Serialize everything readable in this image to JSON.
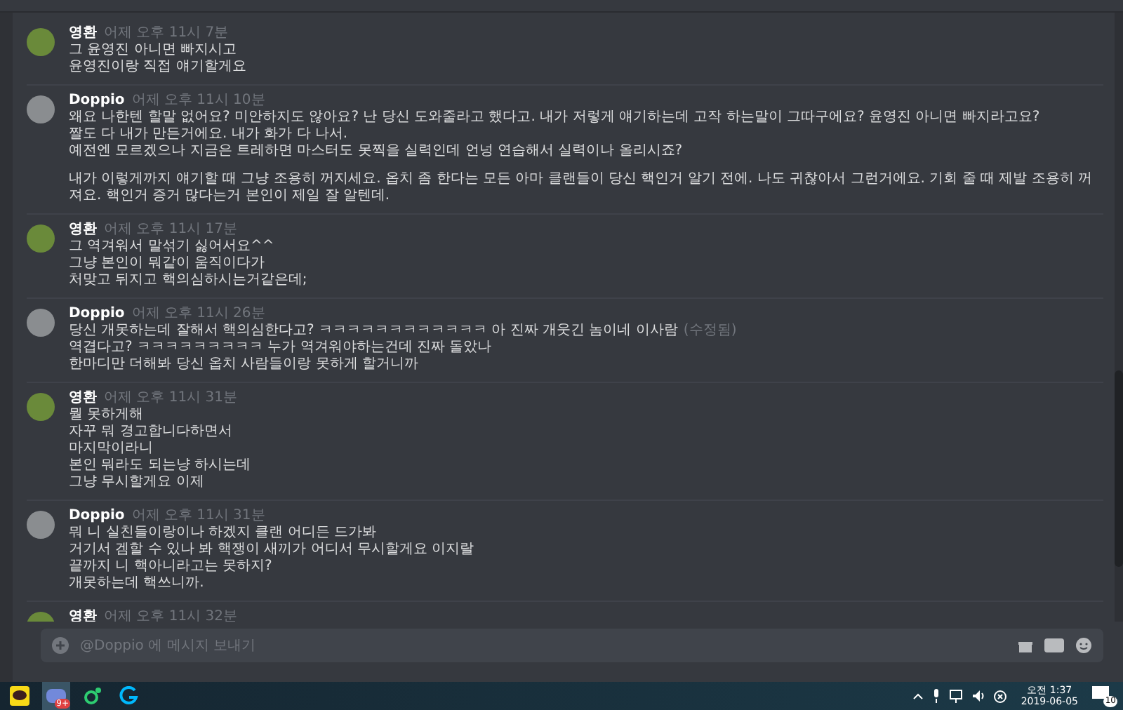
{
  "messages": [
    {
      "author": "영환",
      "time": "어제 오후 11시 7분",
      "color": "#6a8a3a",
      "paragraphs": [
        [
          "그 윤영진 아니면 빠지시고",
          "윤영진이랑 직접 얘기할게요"
        ]
      ]
    },
    {
      "author": "Doppio",
      "time": "어제 오후 11시 10분",
      "color": "#8a8d90",
      "paragraphs": [
        [
          "왜요 나한텐 할말 없어요? 미안하지도 않아요? 난 당신 도와줄라고 했다고. 내가 저렇게 얘기하는데 고작 하는말이 그따구에요? 윤영진 아니면 빠지라고요?",
          "짤도 다 내가 만든거에요. 내가 화가 다 나서.",
          "예전엔 모르겠으나 지금은 트레하면 마스터도 못찍을 실력인데 언넝 연습해서 실력이나 올리시죠?"
        ],
        [
          "내가 이렇게까지 얘기할 때 그냥 조용히 꺼지세요. 옵치 좀 한다는 모든 아마 클랜들이 당신 핵인거 알기 전에. 나도 귀찮아서 그런거에요. 기회 줄 때 제발 조용히 꺼져요. 핵인거 증거 많다는거 본인이 제일 잘 알텐데."
        ]
      ]
    },
    {
      "author": "영환",
      "time": "어제 오후 11시 17분",
      "color": "#6a8a3a",
      "paragraphs": [
        [
          "그 역겨워서 말섞기 싫어서요^^",
          "그냥 본인이 뭐같이 움직이다가",
          "처맞고 뒤지고 핵의심하시는거같은데;"
        ]
      ]
    },
    {
      "author": "Doppio",
      "time": "어제 오후 11시 26분",
      "color": "#8a8d90",
      "edited_tag": "(수정됨)",
      "paragraphs": [
        [
          "당신 개못하는데 잘해서 핵의심한다고? ㅋㅋㅋㅋㅋㅋㅋㅋㅋㅋㅋㅋ 아 진짜 개웃긴 놈이네 이사람",
          "역겹다고? ㅋㅋㅋㅋㅋㅋㅋㅋㅋ 누가 역겨워야하는건데 진짜 돌았나",
          "한마디만 더해봐 당신 옵치 사람들이랑 못하게 할거니까"
        ]
      ]
    },
    {
      "author": "영환",
      "time": "어제 오후 11시 31분",
      "color": "#6a8a3a",
      "paragraphs": [
        [
          "뭘 못하게해",
          "자꾸 뭐 경고합니다하면서",
          "마지막이라니",
          "본인 뭐라도 되는냥 하시는데",
          "그냥 무시할게요 이제"
        ]
      ]
    },
    {
      "author": "Doppio",
      "time": "어제 오후 11시 31분",
      "color": "#8a8d90",
      "paragraphs": [
        [
          "뭐 니 실친들이랑이나 하겠지 클랜 어디든 드가봐",
          "거기서 겜할 수 있나 봐 핵쟁이 새끼가 어디서 무시할게요 이지랄",
          "끝까지 니 핵아니라고는 못하지?",
          "개못하는데 핵쓰니까."
        ]
      ]
    },
    {
      "author": "영환",
      "time": "어제 오후 11시 32분",
      "color": "#6a8a3a"
    }
  ],
  "composer": {
    "placeholder": "@Doppio 에 메시지 보내기"
  },
  "taskbar": {
    "discord_badge": "9+",
    "time": "오전 1:37",
    "date": "2019-06-05",
    "notification_count": "10"
  }
}
